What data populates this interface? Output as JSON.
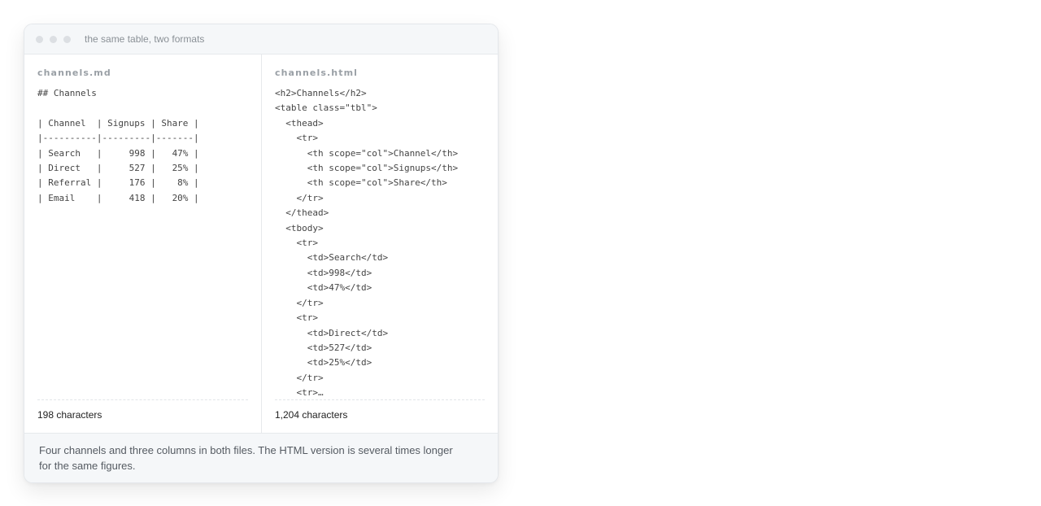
{
  "window": {
    "title": "the same table, two formats"
  },
  "panes": [
    {
      "filename": "channels.md",
      "code": "## Channels\n\n| Channel  | Signups | Share |\n|----------|---------|-------|\n| Search   |     998 |   47% |\n| Direct   |     527 |   25% |\n| Referral |     176 |    8% |\n| Email    |     418 |   20% |",
      "count": "198 characters"
    },
    {
      "filename": "channels.html",
      "code": "<h2>Channels</h2>\n<table class=\"tbl\">\n  <thead>\n    <tr>\n      <th scope=\"col\">Channel</th>\n      <th scope=\"col\">Signups</th>\n      <th scope=\"col\">Share</th>\n    </tr>\n  </thead>\n  <tbody>\n    <tr>\n      <td>Search</td>\n      <td>998</td>\n      <td>47%</td>\n    </tr>\n    <tr>\n      <td>Direct</td>\n      <td>527</td>\n      <td>25%</td>\n    </tr>\n    <tr>…",
      "count": "1,204 characters"
    }
  ],
  "caption": "Four channels and three columns in both files. The HTML version is several times longer for the same figures."
}
